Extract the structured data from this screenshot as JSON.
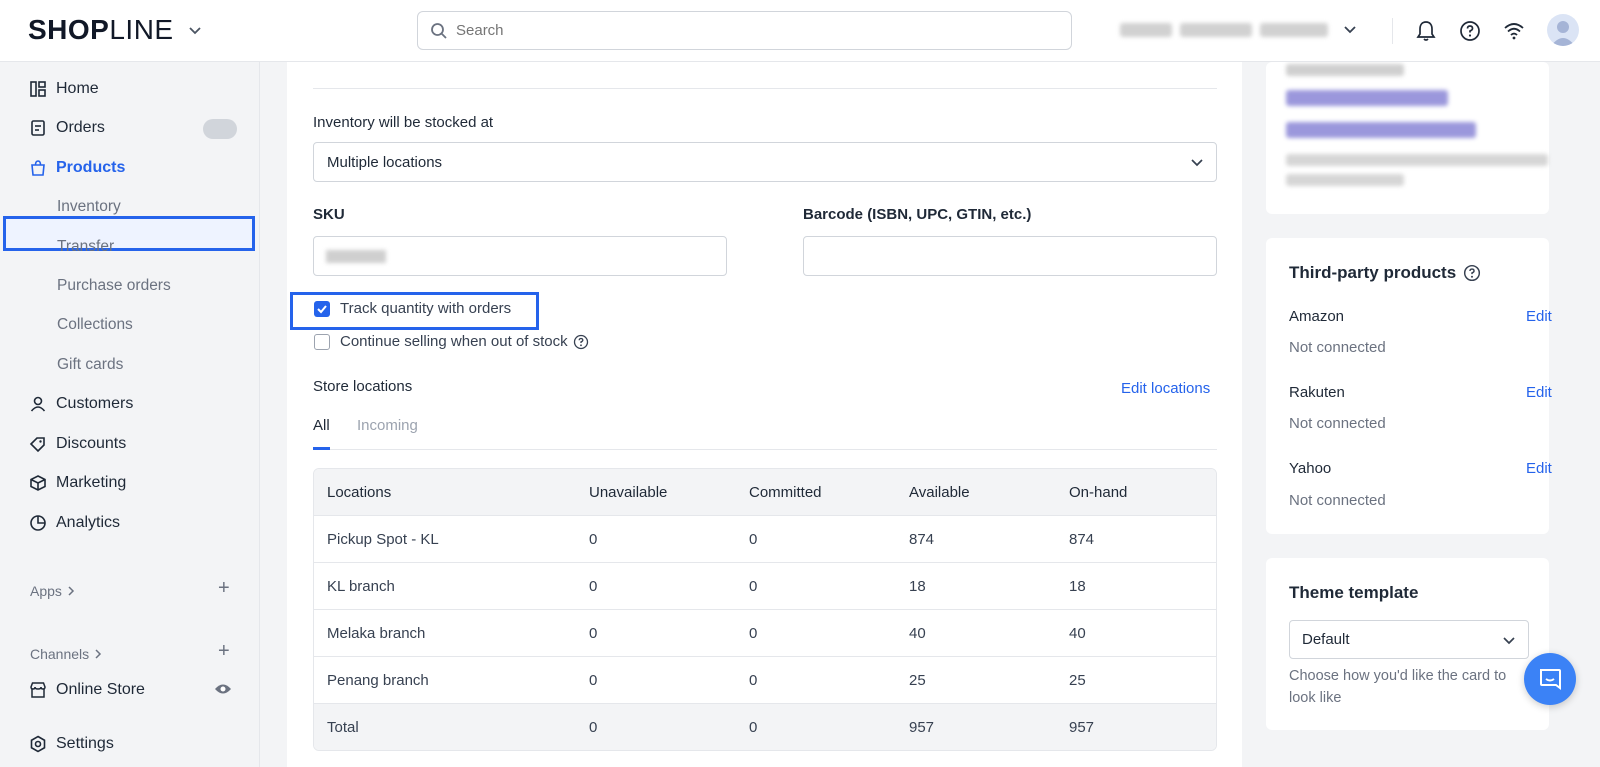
{
  "header": {
    "logo_bold": "SHOP",
    "logo_light": "LINE",
    "search_placeholder": "Search"
  },
  "sidebar": {
    "items": [
      {
        "label": "Home"
      },
      {
        "label": "Orders"
      },
      {
        "label": "Products"
      },
      {
        "label": "Inventory"
      },
      {
        "label": "Transfer"
      },
      {
        "label": "Purchase orders"
      },
      {
        "label": "Collections"
      },
      {
        "label": "Gift cards"
      },
      {
        "label": "Customers"
      },
      {
        "label": "Discounts"
      },
      {
        "label": "Marketing"
      },
      {
        "label": "Analytics"
      }
    ],
    "apps_label": "Apps",
    "channels_label": "Channels",
    "online_store": "Online Store",
    "settings": "Settings"
  },
  "inventory": {
    "stocked_at_label": "Inventory will be stocked at",
    "stocked_at_value": "Multiple locations",
    "sku_label": "SKU",
    "barcode_label": "Barcode (ISBN, UPC, GTIN, etc.)",
    "track_quantity_label": "Track quantity with orders",
    "track_quantity_checked": true,
    "continue_selling_label": "Continue selling when out of stock",
    "continue_selling_checked": false,
    "store_locations_label": "Store locations",
    "edit_locations": "Edit locations",
    "tabs": [
      "All",
      "Incoming"
    ],
    "columns": [
      "Locations",
      "Unavailable",
      "Committed",
      "Available",
      "On-hand"
    ],
    "rows": [
      [
        "Pickup Spot - KL",
        "0",
        "0",
        "874",
        "874"
      ],
      [
        "KL branch",
        "0",
        "0",
        "18",
        "18"
      ],
      [
        "Melaka branch",
        "0",
        "0",
        "40",
        "40"
      ],
      [
        "Penang branch",
        "0",
        "0",
        "25",
        "25"
      ],
      [
        "Total",
        "0",
        "0",
        "957",
        "957"
      ]
    ]
  },
  "third_party": {
    "title": "Third-party products",
    "items": [
      {
        "name": "Amazon",
        "status": "Not connected",
        "action": "Edit"
      },
      {
        "name": "Rakuten",
        "status": "Not connected",
        "action": "Edit"
      },
      {
        "name": "Yahoo",
        "status": "Not connected",
        "action": "Edit"
      }
    ]
  },
  "theme": {
    "title": "Theme template",
    "value": "Default",
    "help": "Choose how you'd like the card to look like"
  },
  "colors": {
    "accent": "#2563eb",
    "highlight_border": "#2563eb"
  }
}
